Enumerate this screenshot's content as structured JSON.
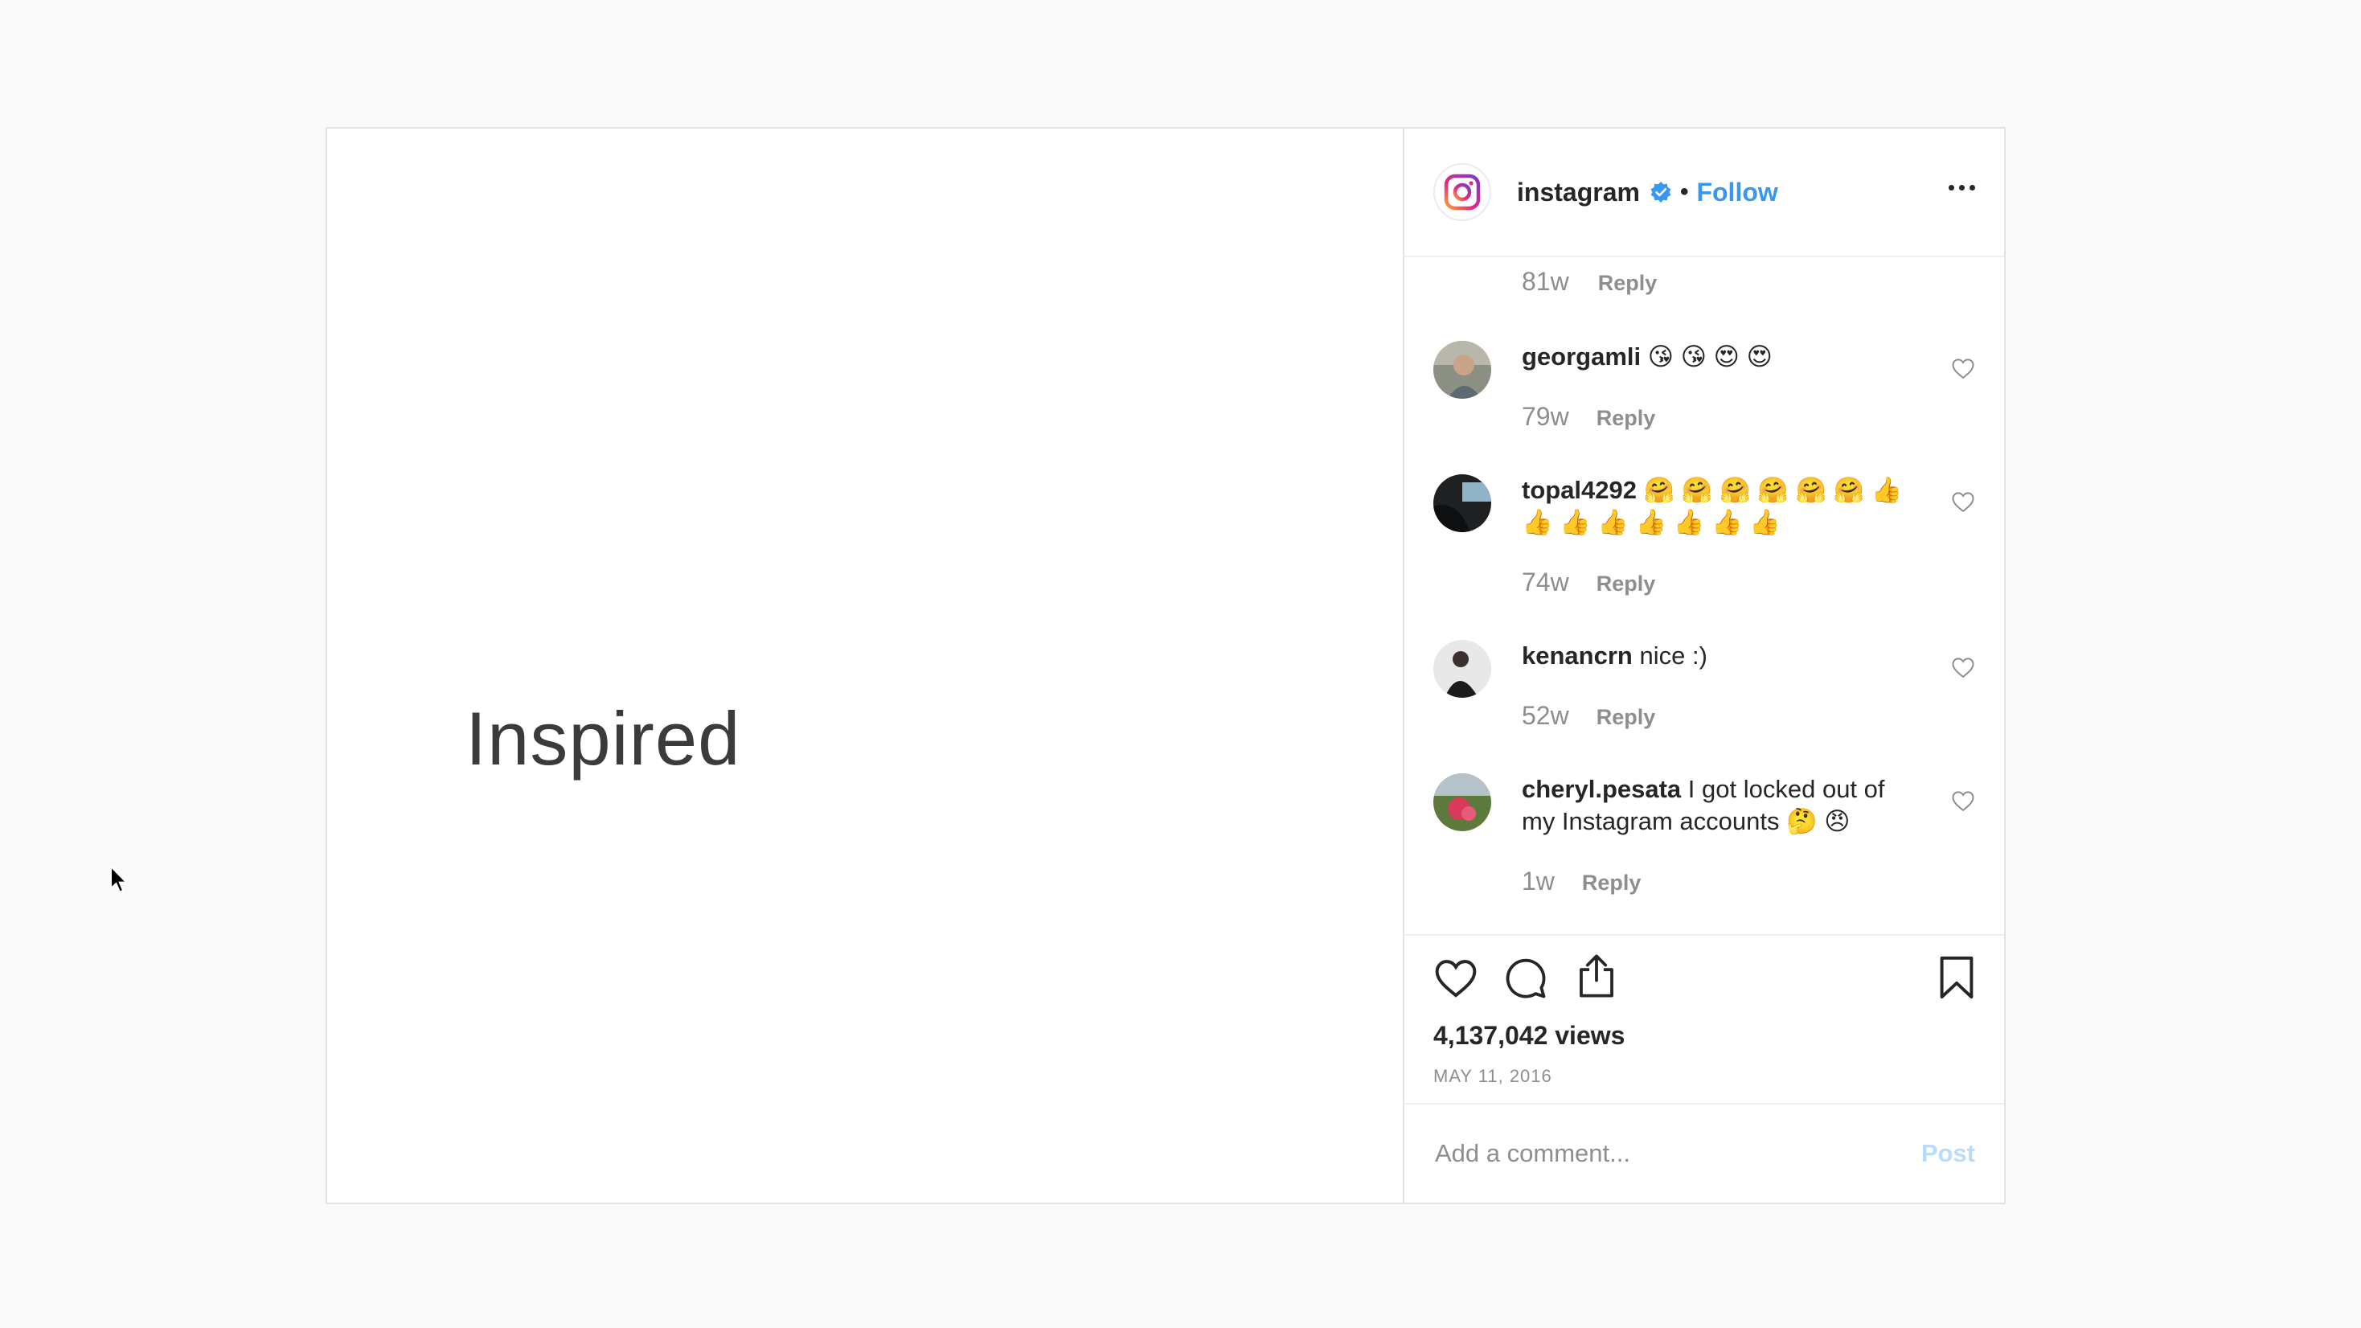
{
  "post": {
    "media_text": "Inspired",
    "header": {
      "username": "instagram",
      "separator": "•",
      "follow_label": "Follow"
    },
    "top_meta": {
      "age": "81w",
      "reply_label": "Reply"
    },
    "comments": [
      {
        "username": "georgamli",
        "text": "😘 😘 😍 😍",
        "age": "79w",
        "reply_label": "Reply"
      },
      {
        "username": "topal4292",
        "text": "🤗 🤗 🤗 🤗 🤗 🤗 👍 👍 👍 👍 👍 👍 👍 👍",
        "age": "74w",
        "reply_label": "Reply"
      },
      {
        "username": "kenancrn",
        "text": "nice :)",
        "age": "52w",
        "reply_label": "Reply"
      },
      {
        "username": "cheryl.pesata",
        "text": "I got locked out of my Instagram accounts 🤔 😠",
        "age": "1w",
        "reply_label": "Reply"
      }
    ],
    "views": "4,137,042 views",
    "date": "MAY 11, 2016",
    "comment_box": {
      "placeholder": "Add a comment...",
      "post_label": "Post"
    },
    "colors": {
      "link_blue": "#3897f0",
      "post_disabled": "#b9dcfb",
      "secondary_text": "#8e8e8e"
    }
  }
}
